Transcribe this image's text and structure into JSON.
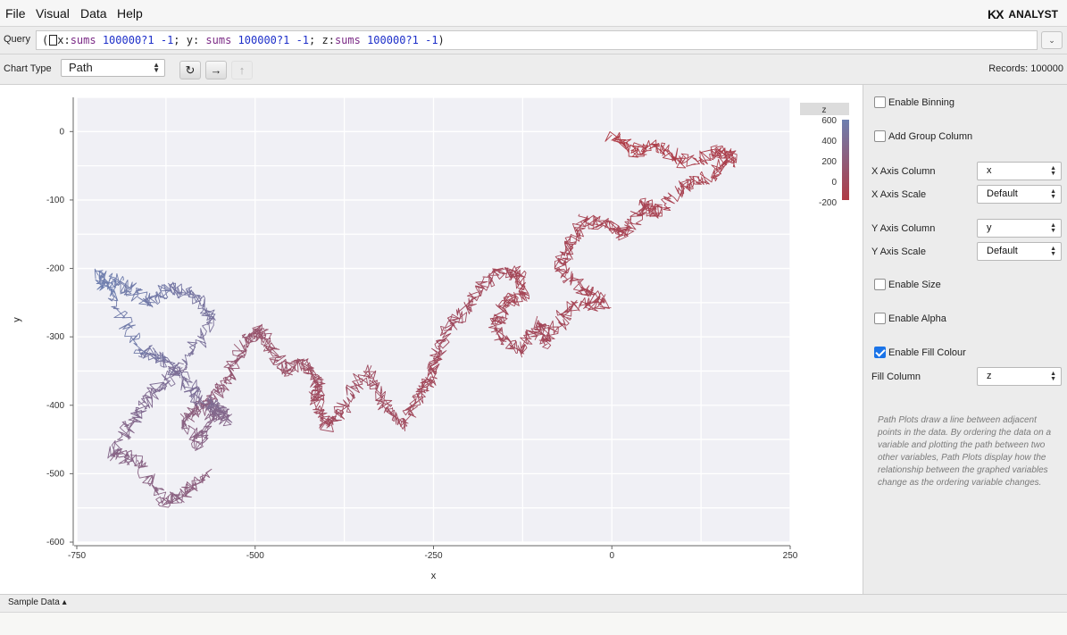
{
  "menu": {
    "file": "File",
    "visual": "Visual",
    "data": "Data",
    "help": "Help"
  },
  "brand": {
    "mark": "KX",
    "name": "ANALYST"
  },
  "query": {
    "label": "Query",
    "prefix": "(",
    "parts": [
      {
        "t": "x:",
        "c": "id"
      },
      {
        "t": "sums",
        "c": "kw"
      },
      {
        "t": " 100000?1 -1",
        "c": "num"
      },
      {
        "t": "; y: ",
        "c": "id"
      },
      {
        "t": "sums",
        "c": "kw"
      },
      {
        "t": " 100000?1 -1",
        "c": "num"
      },
      {
        "t": "; z:",
        "c": "id"
      },
      {
        "t": "sums",
        "c": "kw"
      },
      {
        "t": " 100000?1 -1",
        "c": "num"
      },
      {
        "t": ")",
        "c": "id"
      }
    ],
    "dropdown_icon": "chevron-down-icon"
  },
  "toolbar": {
    "chart_type_label": "Chart Type",
    "chart_type_value": "Path",
    "refresh_icon": "↻",
    "run_icon": "→",
    "up_icon": "↑",
    "records_label": "Records: 100000"
  },
  "chart_data": {
    "type": "line",
    "title": "",
    "xlabel": "x",
    "ylabel": "y",
    "xlim": [
      -750,
      250
    ],
    "ylim": [
      -600,
      50
    ],
    "x_ticks": [
      "-750",
      "-500",
      "-250",
      "0",
      "250"
    ],
    "y_ticks": [
      "0",
      "-100",
      "-200",
      "-300",
      "-400",
      "-500",
      "-600"
    ],
    "grid": true,
    "fill_column": "z",
    "color_scale": {
      "min_color": "#b03a44",
      "max_color": "#6d7fb0"
    },
    "legend": {
      "title": "z",
      "ticks": [
        "600",
        "400",
        "200",
        "0",
        "-200"
      ],
      "placement": "top-right"
    },
    "series": [
      {
        "x": [
          0,
          30,
          60,
          100,
          150,
          170,
          130,
          100,
          60,
          45,
          20,
          0,
          -40,
          -60,
          -75,
          -40,
          -10,
          -60,
          -90,
          -100,
          -130,
          -165,
          -150,
          -125,
          -130,
          -165,
          -200,
          -230,
          -245,
          -255,
          -270,
          -290,
          -320,
          -345,
          -380,
          -400,
          -415,
          -410,
          -430,
          -460,
          -480,
          -500,
          -520,
          -545,
          -570,
          -600,
          -575,
          -560,
          -540,
          -555,
          -580,
          -600,
          -630,
          -660,
          -700,
          -720,
          -690,
          -650,
          -620,
          -580,
          -560,
          -600,
          -640,
          -670,
          -700,
          -665,
          -630,
          -600,
          -570
        ],
        "y": [
          -5,
          -30,
          -20,
          -45,
          -30,
          -40,
          -70,
          -80,
          -120,
          -105,
          -150,
          -140,
          -130,
          -170,
          -200,
          -230,
          -250,
          -255,
          -310,
          -280,
          -320,
          -290,
          -250,
          -240,
          -205,
          -210,
          -250,
          -290,
          -330,
          -360,
          -380,
          -430,
          -395,
          -350,
          -410,
          -430,
          -390,
          -370,
          -340,
          -350,
          -310,
          -290,
          -320,
          -370,
          -400,
          -420,
          -460,
          -410,
          -420,
          -400,
          -390,
          -360,
          -330,
          -320,
          -240,
          -210,
          -220,
          -250,
          -230,
          -240,
          -280,
          -340,
          -380,
          -420,
          -470,
          -480,
          -540,
          -530,
          -500
        ],
        "z": [
          -200,
          -180,
          -160,
          -150,
          -130,
          -140,
          -120,
          -100,
          -110,
          -90,
          -80,
          -100,
          -90,
          -70,
          -60,
          -80,
          -90,
          -60,
          -40,
          -50,
          -30,
          -40,
          -60,
          -70,
          -60,
          -40,
          -20,
          0,
          -20,
          -40,
          -30,
          -10,
          0,
          20,
          0,
          -20,
          -10,
          10,
          40,
          60,
          80,
          100,
          120,
          150,
          200,
          250,
          280,
          300,
          320,
          360,
          400,
          430,
          470,
          520,
          580,
          600,
          560,
          540,
          520,
          480,
          460,
          420,
          380,
          340,
          300,
          280,
          260,
          240,
          220
        ]
      }
    ]
  },
  "panel": {
    "enable_binning": "Enable Binning",
    "add_group_column": "Add Group Column",
    "x_axis_column_label": "X Axis Column",
    "x_axis_column_value": "x",
    "x_axis_scale_label": "X Axis Scale",
    "x_axis_scale_value": "Default",
    "y_axis_column_label": "Y Axis Column",
    "y_axis_column_value": "y",
    "y_axis_scale_label": "Y Axis Scale",
    "y_axis_scale_value": "Default",
    "enable_size": "Enable Size",
    "enable_alpha": "Enable Alpha",
    "enable_fill_colour": "Enable Fill Colour",
    "fill_column_label": "Fill Column",
    "fill_column_value": "z",
    "help_text": "Path Plots draw a line between adjacent points in the data. By ordering the data on a variable and plotting the path between two other variables, Path Plots display how the relationship between the graphed variables change as the ordering variable changes."
  },
  "bottom": {
    "sample_data": "Sample Data ▴"
  }
}
